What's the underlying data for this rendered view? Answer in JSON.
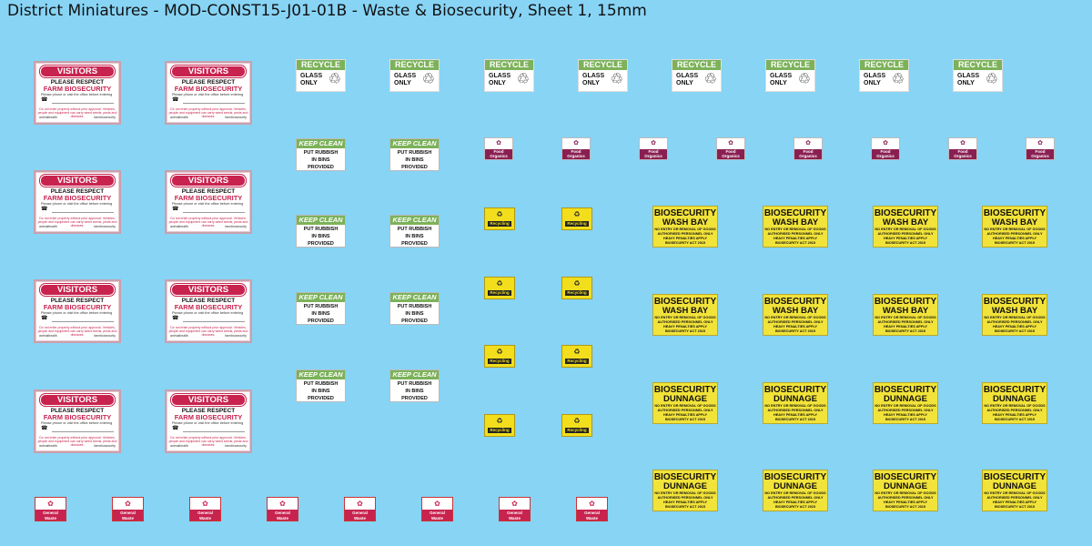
{
  "title": "District Miniatures - MOD-CONST15-J01-01B - Waste & Biosecurity, Sheet 1, 15mm",
  "visitors": {
    "header": "VISITORS",
    "line1": "PLEASE RESPECT",
    "line2": "FARM BIOSECURITY",
    "line3": "Please phone or visit the office before entering",
    "phone_icon": "☎",
    "line4": "Do not enter property without prior approval. Vehicles, people and equipment can carry weed seeds, pests and diseases.",
    "footer_left": "animalhealth",
    "footer_right": "farmbiosecurity"
  },
  "recycle": {
    "header": "RECYCLE",
    "line1": "GLASS",
    "line2": "ONLY",
    "icon": "♲"
  },
  "keep": {
    "header": "KEEP CLEAN",
    "line1": "PUT RUBBISH",
    "line2": "IN BINS",
    "line3": "PROVIDED"
  },
  "food": {
    "icon": "✿",
    "line1": "Food",
    "line2": "Organics"
  },
  "recycling": {
    "icon": "♻",
    "label": "Recycling"
  },
  "washbay": {
    "line1": "BIOSECURITY",
    "line2": "WASH BAY",
    "line3": "NO ENTRY OR REMOVAL OF GOODS",
    "line4": "AUTHORISED PERSONNEL ONLY",
    "line5": "HEAVY PENALTIES APPLY",
    "line6": "BIOSECURITY ACT 2015"
  },
  "dunnage": {
    "line1": "BIOSECURITY",
    "line2": "DUNNAGE",
    "line3": "NO ENTRY OR REMOVAL OF GOODS",
    "line4": "AUTHORISED PERSONNEL ONLY",
    "line5": "HEAVY PENALTIES APPLY",
    "line6": "BIOSECURITY ACT 2015"
  },
  "general": {
    "icon": "✿",
    "line1": "General",
    "line2": "Waste"
  },
  "colors": {
    "background": "#87d4f5",
    "visitors_red": "#c8234f",
    "recycle_green": "#7cb25a",
    "food_purple": "#8a1f52",
    "bio_yellow": "#f2e33a"
  }
}
